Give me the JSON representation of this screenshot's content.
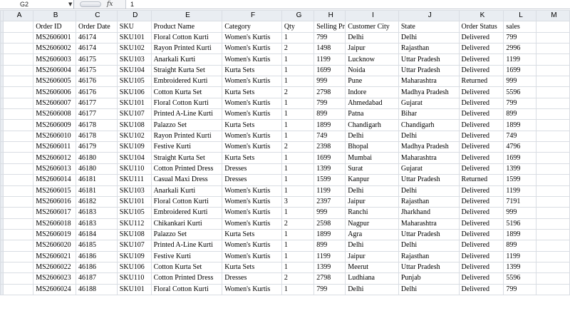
{
  "formula_bar": {
    "name_box": "G2",
    "fx_label": "fx",
    "formula_value": "1"
  },
  "columns": [
    "A",
    "B",
    "C",
    "D",
    "E",
    "F",
    "G",
    "H",
    "I",
    "J",
    "K",
    "L",
    "M"
  ],
  "rows": [
    [
      "",
      "Order ID",
      "Order Date",
      "SKU",
      "Product Name",
      "Category",
      "Qty",
      "Selling Pr",
      "Customer City",
      "State",
      "Order Status",
      "sales",
      ""
    ],
    [
      "",
      "MS2606001",
      "46174",
      "SKU101",
      "Floral Cotton Kurti",
      "Women's Kurtis",
      "1",
      "799",
      "Delhi",
      "Delhi",
      "Delivered",
      "799",
      ""
    ],
    [
      "",
      "MS2606002",
      "46174",
      "SKU102",
      "Rayon Printed Kurti",
      "Women's Kurtis",
      "2",
      "1498",
      "Jaipur",
      "Rajasthan",
      "Delivered",
      "2996",
      ""
    ],
    [
      "",
      "MS2606003",
      "46175",
      "SKU103",
      "Anarkali Kurti",
      "Women's Kurtis",
      "1",
      "1199",
      "Lucknow",
      "Uttar Pradesh",
      "Delivered",
      "1199",
      ""
    ],
    [
      "",
      "MS2606004",
      "46175",
      "SKU104",
      "Straight Kurta Set",
      "Kurta Sets",
      "1",
      "1699",
      "Noida",
      "Uttar Pradesh",
      "Delivered",
      "1699",
      ""
    ],
    [
      "",
      "MS2606005",
      "46176",
      "SKU105",
      "Embroidered Kurti",
      "Women's Kurtis",
      "1",
      "999",
      "Pune",
      "Maharashtra",
      "Returned",
      "999",
      ""
    ],
    [
      "",
      "MS2606006",
      "46176",
      "SKU106",
      "Cotton Kurta Set",
      "Kurta Sets",
      "2",
      "2798",
      "Indore",
      "Madhya Pradesh",
      "Delivered",
      "5596",
      ""
    ],
    [
      "",
      "MS2606007",
      "46177",
      "SKU101",
      "Floral Cotton Kurti",
      "Women's Kurtis",
      "1",
      "799",
      "Ahmedabad",
      "Gujarat",
      "Delivered",
      "799",
      ""
    ],
    [
      "",
      "MS2606008",
      "46177",
      "SKU107",
      "Printed A-Line Kurti",
      "Women's Kurtis",
      "1",
      "899",
      "Patna",
      "Bihar",
      "Delivered",
      "899",
      ""
    ],
    [
      "",
      "MS2606009",
      "46178",
      "SKU108",
      "Palazzo Set",
      "Kurta Sets",
      "1",
      "1899",
      "Chandigarh",
      "Chandigarh",
      "Delivered",
      "1899",
      ""
    ],
    [
      "",
      "MS2606010",
      "46178",
      "SKU102",
      "Rayon Printed Kurti",
      "Women's Kurtis",
      "1",
      "749",
      "Delhi",
      "Delhi",
      "Delivered",
      "749",
      ""
    ],
    [
      "",
      "MS2606011",
      "46179",
      "SKU109",
      "Festive Kurti",
      "Women's Kurtis",
      "2",
      "2398",
      "Bhopal",
      "Madhya Pradesh",
      "Delivered",
      "4796",
      ""
    ],
    [
      "",
      "MS2606012",
      "46180",
      "SKU104",
      "Straight Kurta Set",
      "Kurta Sets",
      "1",
      "1699",
      "Mumbai",
      "Maharashtra",
      "Delivered",
      "1699",
      ""
    ],
    [
      "",
      "MS2606013",
      "46180",
      "SKU110",
      "Cotton Printed Dress",
      "Dresses",
      "1",
      "1399",
      "Surat",
      "Gujarat",
      "Delivered",
      "1399",
      ""
    ],
    [
      "",
      "MS2606014",
      "46181",
      "SKU111",
      "Casual Maxi Dress",
      "Dresses",
      "1",
      "1599",
      "Kanpur",
      "Uttar Pradesh",
      "Returned",
      "1599",
      ""
    ],
    [
      "",
      "MS2606015",
      "46181",
      "SKU103",
      "Anarkali Kurti",
      "Women's Kurtis",
      "1",
      "1199",
      "Delhi",
      "Delhi",
      "Delivered",
      "1199",
      ""
    ],
    [
      "",
      "MS2606016",
      "46182",
      "SKU101",
      "Floral Cotton Kurti",
      "Women's Kurtis",
      "3",
      "2397",
      "Jaipur",
      "Rajasthan",
      "Delivered",
      "7191",
      ""
    ],
    [
      "",
      "MS2606017",
      "46183",
      "SKU105",
      "Embroidered Kurti",
      "Women's Kurtis",
      "1",
      "999",
      "Ranchi",
      "Jharkhand",
      "Delivered",
      "999",
      ""
    ],
    [
      "",
      "MS2606018",
      "46183",
      "SKU112",
      "Chikankari Kurti",
      "Women's Kurtis",
      "2",
      "2598",
      "Nagpur",
      "Maharashtra",
      "Delivered",
      "5196",
      ""
    ],
    [
      "",
      "MS2606019",
      "46184",
      "SKU108",
      "Palazzo Set",
      "Kurta Sets",
      "1",
      "1899",
      "Agra",
      "Uttar Pradesh",
      "Delivered",
      "1899",
      ""
    ],
    [
      "",
      "MS2606020",
      "46185",
      "SKU107",
      "Printed A-Line Kurti",
      "Women's Kurtis",
      "1",
      "899",
      "Delhi",
      "Delhi",
      "Delivered",
      "899",
      ""
    ],
    [
      "",
      "MS2606021",
      "46186",
      "SKU109",
      "Festive Kurti",
      "Women's Kurtis",
      "1",
      "1199",
      "Jaipur",
      "Rajasthan",
      "Delivered",
      "1199",
      ""
    ],
    [
      "",
      "MS2606022",
      "46186",
      "SKU106",
      "Cotton Kurta Set",
      "Kurta Sets",
      "1",
      "1399",
      "Meerut",
      "Uttar Pradesh",
      "Delivered",
      "1399",
      ""
    ],
    [
      "",
      "MS2606023",
      "46187",
      "SKU110",
      "Cotton Printed Dress",
      "Dresses",
      "2",
      "2798",
      "Ludhiana",
      "Punjab",
      "Delivered",
      "5596",
      ""
    ],
    [
      "",
      "MS2606024",
      "46188",
      "SKU101",
      "Floral Cotton Kurti",
      "Women's Kurtis",
      "1",
      "799",
      "Delhi",
      "Delhi",
      "Delivered",
      "799",
      ""
    ]
  ]
}
